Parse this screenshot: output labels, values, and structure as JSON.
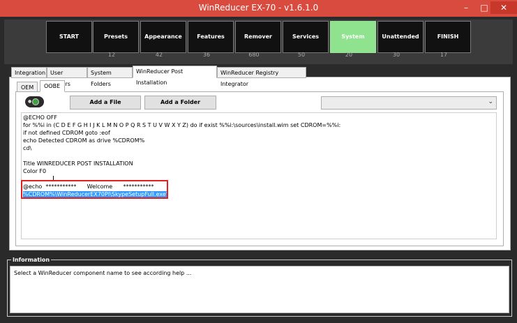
{
  "window": {
    "title": "WinReducer EX-70 - v1.6.1.0",
    "minimize": "–",
    "maximize": "□",
    "close": "✕"
  },
  "steps": [
    {
      "label": "START",
      "count": ""
    },
    {
      "label": "Presets",
      "count": "12"
    },
    {
      "label": "Appearance",
      "count": "42"
    },
    {
      "label": "Features",
      "count": "36"
    },
    {
      "label": "Remover",
      "count": "680"
    },
    {
      "label": "Services",
      "count": "50"
    },
    {
      "label": "System",
      "count": "20"
    },
    {
      "label": "Unattended",
      "count": "30"
    },
    {
      "label": "FINISH",
      "count": "17"
    }
  ],
  "tabs": [
    "Integration",
    "User Folders",
    "System Folders",
    "WinReducer Post Installation",
    "WinReducer Registry Integrator"
  ],
  "subtabs": [
    "OEM",
    "OOBE"
  ],
  "toolbar": {
    "add_file": "Add a File",
    "add_folder": "Add a Folder",
    "dropdown_value": ""
  },
  "editor": {
    "lines": [
      "@ECHO OFF",
      "for %%i in (C D E F G H I J K L M N O P Q R S T U V W X Y Z) do if exist %%i:\\sources\\install.wim set CDROM=%%i:",
      "if not defined CDROM goto :eof",
      "echo Detected CDROM as drive %CDROM%",
      "cd\\",
      "",
      "Title WINREDUCER POST INSTALLATION",
      "Color F0",
      "",
      "@echo  ***********      Welcome      ***********",
      "%CDROM%\\WinReducerEX70PI\\SkypeSetupFull.exe\""
    ]
  },
  "info": {
    "title": "Information",
    "text": "Select a WinReducer component name to see according help ..."
  },
  "colors": {
    "accent": "#d84b3e",
    "active_step": "#8fe38f",
    "selection": "#3399ff",
    "highlight": "#e41e1e"
  }
}
